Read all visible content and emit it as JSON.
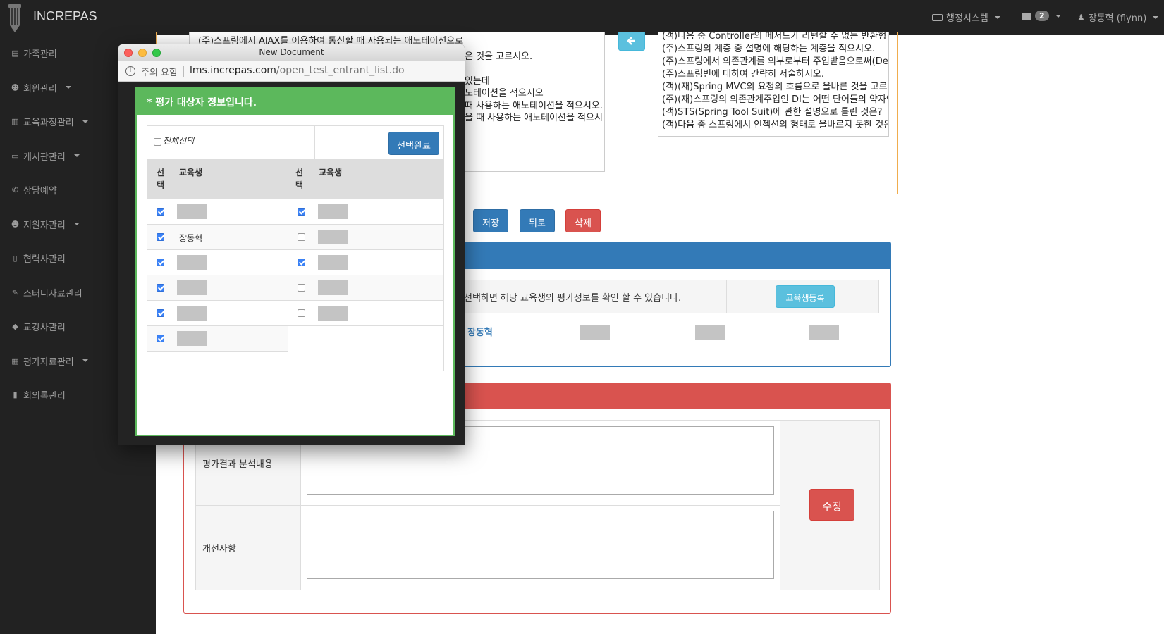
{
  "navbar": {
    "brand": "INCREPAS",
    "admin_menu": "행정시스템",
    "mail_count": "2",
    "user": "장동혁 (flynn)"
  },
  "sidebar": {
    "items": [
      {
        "label": "가족관리",
        "icon": "id-card-icon",
        "dropdown": false
      },
      {
        "label": "회원관리",
        "icon": "user-plus-icon",
        "dropdown": true
      },
      {
        "label": "교육과정관리",
        "icon": "bank-icon",
        "dropdown": true
      },
      {
        "label": "게시판관리",
        "icon": "desktop-icon",
        "dropdown": true
      },
      {
        "label": "상담예약",
        "icon": "phone-icon",
        "dropdown": false
      },
      {
        "label": "지원자관리",
        "icon": "user-icon",
        "dropdown": true
      },
      {
        "label": "협력사관리",
        "icon": "building-icon",
        "dropdown": false
      },
      {
        "label": "스터디자료관리",
        "icon": "pencil-icon",
        "dropdown": false
      },
      {
        "label": "교강사관리",
        "icon": "graduation-cap-icon",
        "dropdown": false
      },
      {
        "label": "평가자료관리",
        "icon": "bar-chart-icon",
        "dropdown": true
      },
      {
        "label": "회의록관리",
        "icon": "book-icon",
        "dropdown": false
      }
    ]
  },
  "questions_left": [
    "(주)스프링에서 AJAX를 이용하여 통신할 때 사용되는 애노테이션으로",
    "은 것을 고르시오.",
    "있는데",
    "노테이션을 적으시오",
    "때 사용하는 애노테이션을 적으시오.",
    "을 때 사용하는 애노테이션을 적으시"
  ],
  "questions_right": [
    "(객)다음 중 Controller의 메서드가 리턴할 수 없는 반환형을",
    "(주)스프링의 계층 중 설명에 해당하는 계층을 적으시오.",
    "(주)스프링에서 의존관계를 외부로부터 주입받음으로써(Dep",
    "(주)스프링빈에 대하여 간략히 서술하시오.",
    "(객)(재)Spring MVC의 요청의 흐름으로 올바른 것을 고르시",
    "(주)(재)스프링의 의존관계주입인 DI는 어떤 단어들의 약자인",
    "(객)STS(Spring Tool Suit)에 관한 설명으로 틀린 것은?",
    "(객)다음 중 스프링에서 인젝션의 형태로 올바르지 못한 것은"
  ],
  "actions": {
    "save": "저장",
    "back": "뒤로",
    "delete": "삭제"
  },
  "students_panel": {
    "info_text": "선택하면 해당 교육생의 평가정보를 확인 할 수 있습니다.",
    "register_button": "교육생등록",
    "student_name": "장동혁"
  },
  "eval_panel": {
    "analysis_label": "평가결과 분석내용",
    "improvement_label": "개선사항",
    "edit_button": "수정"
  },
  "popup": {
    "window_title": "New Document",
    "security_text": "주의 요함",
    "url_host": "lms.increpas.com",
    "url_path": "/open_test_entrant_list.do",
    "header": "* 평가 대상자 정보입니다.",
    "select_all": "전체선택",
    "complete_button": "선택완료",
    "col_select": "선택",
    "col_select_top": "선",
    "col_select_bottom": "택",
    "col_student": "교육생",
    "left_rows": [
      {
        "checked": true,
        "name": ""
      },
      {
        "checked": true,
        "name": "장동혁"
      },
      {
        "checked": true,
        "name": ""
      },
      {
        "checked": true,
        "name": ""
      },
      {
        "checked": true,
        "name": ""
      },
      {
        "checked": true,
        "name": ""
      }
    ],
    "right_rows": [
      {
        "checked": true,
        "name": ""
      },
      {
        "checked": false,
        "name": ""
      },
      {
        "checked": true,
        "name": ""
      },
      {
        "checked": false,
        "name": ""
      },
      {
        "checked": false,
        "name": ""
      }
    ]
  },
  "colors": {
    "navbar": "#222222",
    "primary": "#337ab7",
    "danger": "#d9534f",
    "success": "#5cb85c",
    "info": "#5bc0de",
    "warning": "#f0ad4e"
  }
}
